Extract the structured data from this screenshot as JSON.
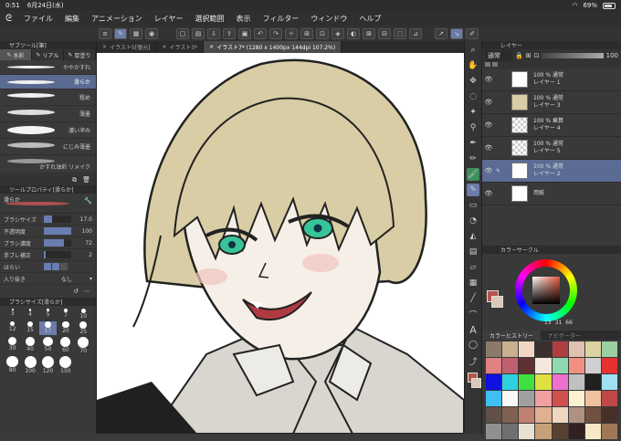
{
  "status": {
    "time": "0:51",
    "date": "6月24日(水)",
    "battery": "69%"
  },
  "menu": [
    "ファイル",
    "編集",
    "アニメーション",
    "レイヤー",
    "選択範囲",
    "表示",
    "フィルター",
    "ウィンドウ",
    "ヘルプ"
  ],
  "subtool": {
    "header": "サブツール[筆]",
    "tabs": [
      "水彩",
      "リアル",
      "厚塗り"
    ],
    "brushes": [
      "ややかすれ",
      "滑らか",
      "粗め",
      "薄墨",
      "濃い滲み",
      "にじみ薄墨",
      "かすれ油彩 リメイク"
    ]
  },
  "toolprop": {
    "header": "ツールプロパティ[滑らか]",
    "name": "滑らか",
    "props": [
      {
        "label": "ブラシサイズ",
        "value": "17.0",
        "level": 0.3
      },
      {
        "label": "不透明度",
        "value": "100",
        "level": 1.0
      },
      {
        "label": "ブラシ濃度",
        "value": "72",
        "level": 0.72
      },
      {
        "label": "手ブレ補正",
        "value": "2",
        "level": 0.05
      }
    ],
    "harai_label": "はらい",
    "nukishi_label": "入り抜き",
    "nukishi_value": "なし"
  },
  "brushsize": {
    "header": "ブラシサイズ[滑らか]",
    "sizes": [
      "3",
      "4",
      "5",
      "7",
      "10",
      "12",
      "15",
      "17",
      "20",
      "25",
      "30",
      "40",
      "50",
      "60",
      "70",
      "80",
      "100",
      "120",
      "150"
    ]
  },
  "docs": [
    "イラスト5[復元]",
    "イラスト3*",
    "イラスト7* (1280 x 1400px 144dpi 107.2%)"
  ],
  "layers": {
    "header": "レイヤー",
    "blend": "通常",
    "opacity": "100",
    "rows": [
      {
        "l1": "100 % 通常",
        "l2": "レイヤー 1"
      },
      {
        "l1": "100 % 通常",
        "l2": "レイヤー 3"
      },
      {
        "l1": "100 % 乗算",
        "l2": "レイヤー 4"
      },
      {
        "l1": "100 % 通常",
        "l2": "レイヤー 5"
      },
      {
        "l1": "100 % 通常",
        "l2": "レイヤー 2"
      },
      {
        "l1": "",
        "l2": "用紙"
      }
    ]
  },
  "colorcircle": {
    "header": "カラーサークル",
    "h": "13",
    "s": "31",
    "v": "66"
  },
  "history": {
    "header": "カラーヒストリー",
    "tab2": "ナビゲーター",
    "colors": [
      "#8a7a6a",
      "#c9b08e",
      "#f0d6c4",
      "#3a3030",
      "#b04040",
      "#e0c0b0",
      "#ddd3a0",
      "#9ad0a0",
      "#e08080",
      "#c06070",
      "#603030",
      "#f4e8dc",
      "#8fd8b0",
      "#f09080",
      "#d0d0d0",
      "#e83030",
      "#1010e0",
      "#30d0e0",
      "#40e040",
      "#e0e040",
      "#f070d0",
      "#c0c0c0",
      "#202020",
      "#a0e0f0",
      "#40c0f0",
      "#f8f8f8",
      "#a0a0a0",
      "#f0a0a0",
      "#d05050",
      "#fff0d0",
      "#f0c0a0",
      "#c04848",
      "#605048",
      "#806050",
      "#c08070",
      "#e0b090",
      "#f0d8c0",
      "#b09080",
      "#705040",
      "#483028",
      "#909090",
      "#707070",
      "#e8e0d0",
      "#c8a078",
      "#5a4030",
      "#302020",
      "#f8e8c8",
      "#a07858"
    ]
  },
  "colors": {
    "accent": "#6b7ca8",
    "main_color": "#b4544c",
    "sub_color": "#d9c9b8"
  }
}
